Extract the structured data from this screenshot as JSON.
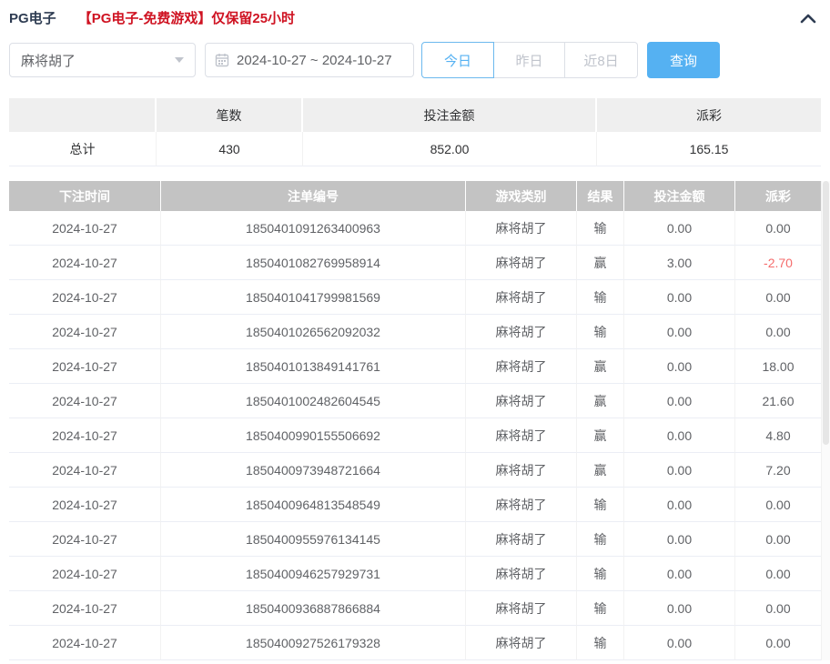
{
  "page": {
    "title": "PG电子",
    "notice": "【PG电子-免费游戏】仅保留25小时"
  },
  "filters": {
    "game_select": {
      "value": "麻将胡了"
    },
    "date_range": {
      "value": "2024-10-27 ~ 2024-10-27"
    },
    "quick_buttons": [
      {
        "label": "今日",
        "active": true
      },
      {
        "label": "昨日",
        "active": false
      },
      {
        "label": "近8日",
        "active": false
      }
    ],
    "search_button": {
      "label": "查询"
    }
  },
  "summary": {
    "columns": [
      "",
      "笔数",
      "投注金额",
      "派彩"
    ],
    "total": {
      "label": "总计",
      "count": "430",
      "bet_amount": "852.00",
      "payout": "165.15"
    }
  },
  "table": {
    "columns": [
      "下注时间",
      "注单编号",
      "游戏类别",
      "结果",
      "投注金额",
      "派彩"
    ],
    "rows": [
      {
        "date": "2024-10-27",
        "bet_id": "1850401091263400963",
        "game": "麻将胡了",
        "result": "输",
        "bet": "0.00",
        "payout": "0.00"
      },
      {
        "date": "2024-10-27",
        "bet_id": "1850401082769958914",
        "game": "麻将胡了",
        "result": "赢",
        "bet": "3.00",
        "payout": "-2.70"
      },
      {
        "date": "2024-10-27",
        "bet_id": "1850401041799981569",
        "game": "麻将胡了",
        "result": "输",
        "bet": "0.00",
        "payout": "0.00"
      },
      {
        "date": "2024-10-27",
        "bet_id": "1850401026562092032",
        "game": "麻将胡了",
        "result": "输",
        "bet": "0.00",
        "payout": "0.00"
      },
      {
        "date": "2024-10-27",
        "bet_id": "1850401013849141761",
        "game": "麻将胡了",
        "result": "赢",
        "bet": "0.00",
        "payout": "18.00"
      },
      {
        "date": "2024-10-27",
        "bet_id": "1850401002482604545",
        "game": "麻将胡了",
        "result": "赢",
        "bet": "0.00",
        "payout": "21.60"
      },
      {
        "date": "2024-10-27",
        "bet_id": "1850400990155506692",
        "game": "麻将胡了",
        "result": "赢",
        "bet": "0.00",
        "payout": "4.80"
      },
      {
        "date": "2024-10-27",
        "bet_id": "1850400973948721664",
        "game": "麻将胡了",
        "result": "赢",
        "bet": "0.00",
        "payout": "7.20"
      },
      {
        "date": "2024-10-27",
        "bet_id": "1850400964813548549",
        "game": "麻将胡了",
        "result": "输",
        "bet": "0.00",
        "payout": "0.00"
      },
      {
        "date": "2024-10-27",
        "bet_id": "1850400955976134145",
        "game": "麻将胡了",
        "result": "输",
        "bet": "0.00",
        "payout": "0.00"
      },
      {
        "date": "2024-10-27",
        "bet_id": "1850400946257929731",
        "game": "麻将胡了",
        "result": "输",
        "bet": "0.00",
        "payout": "0.00"
      },
      {
        "date": "2024-10-27",
        "bet_id": "1850400936887866884",
        "game": "麻将胡了",
        "result": "输",
        "bet": "0.00",
        "payout": "0.00"
      },
      {
        "date": "2024-10-27",
        "bet_id": "1850400927526179328",
        "game": "麻将胡了",
        "result": "输",
        "bet": "0.00",
        "payout": "0.00"
      }
    ]
  },
  "colors": {
    "accent_blue": "#55b1f2",
    "title_navy": "#2e3c52",
    "notice_red": "#cf1322",
    "negative_red": "#f56c6c",
    "table_header_gray": "#c3c3c3"
  }
}
